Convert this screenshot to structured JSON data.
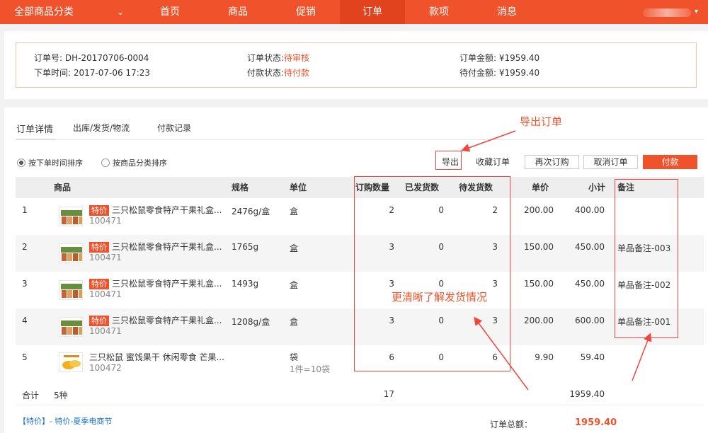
{
  "nav": {
    "category": "全部商品分类",
    "items": [
      "首页",
      "商品",
      "促销",
      "订单",
      "款项",
      "消息"
    ]
  },
  "summary": {
    "order_no_label": "订单号:",
    "order_no": "DH-20170706-0004",
    "order_time_label": "下单时间:",
    "order_time": "2017-07-06 17:23",
    "order_status_label": "订单状态:",
    "order_status": "待审核",
    "pay_status_label": "付款状态:",
    "pay_status": "待付款",
    "amount_label": "订单金额:",
    "amount": "¥1959.40",
    "due_label": "待付金额:",
    "due": "¥1959.40"
  },
  "tabs": [
    "订单详情",
    "出库/发货/物流",
    "付款记录"
  ],
  "sort": {
    "by_time": "按下单时间排序",
    "by_category": "按商品分类排序"
  },
  "actions": {
    "export": "导出",
    "favorite": "收藏订单",
    "reorder": "再次订购",
    "cancel": "取消订单",
    "pay": "付款"
  },
  "table": {
    "headers": {
      "product": "商品",
      "spec": "规格",
      "unit": "单位",
      "ordered": "订购数量",
      "shipped": "已发货数",
      "pending": "待发货数",
      "price": "单价",
      "subtotal": "小计",
      "remark": "备注"
    },
    "rows": [
      {
        "idx": "1",
        "tag": "特价",
        "name": "三只松鼠零食特产干果礼盒...",
        "code": "100471",
        "spec": "2476g/盒",
        "unit": "盒",
        "unit_note": "",
        "ordered": "2",
        "shipped": "0",
        "pending": "2",
        "price": "200.00",
        "subtotal": "400.00",
        "remark": ""
      },
      {
        "idx": "2",
        "tag": "特价",
        "name": "三只松鼠零食特产干果礼盒...",
        "code": "100471",
        "spec": "1765g",
        "unit": "盒",
        "unit_note": "",
        "ordered": "3",
        "shipped": "0",
        "pending": "3",
        "price": "150.00",
        "subtotal": "450.00",
        "remark": "单品备注-003"
      },
      {
        "idx": "3",
        "tag": "特价",
        "name": "三只松鼠零食特产干果礼盒...",
        "code": "100471",
        "spec": "1493g",
        "unit": "盒",
        "unit_note": "",
        "ordered": "3",
        "shipped": "0",
        "pending": "3",
        "price": "150.00",
        "subtotal": "450.00",
        "remark": "单品备注-002"
      },
      {
        "idx": "4",
        "tag": "特价",
        "name": "三只松鼠零食特产干果礼盒...",
        "code": "100471",
        "spec": "1208g/盒",
        "unit": "盒",
        "unit_note": "",
        "ordered": "3",
        "shipped": "0",
        "pending": "3",
        "price": "200.00",
        "subtotal": "600.00",
        "remark": "单品备注-001"
      },
      {
        "idx": "5",
        "tag": "",
        "name": "三只松鼠 蜜饯果干 休闲零食 芒果...",
        "code": "100472",
        "spec": "",
        "unit": "袋",
        "unit_note": "1件=10袋",
        "ordered": "6",
        "shipped": "0",
        "pending": "6",
        "price": "9.90",
        "subtotal": "59.40",
        "remark": ""
      }
    ],
    "total": {
      "label": "合计",
      "kinds": "5种",
      "ordered": "17",
      "subtotal": "1959.40"
    }
  },
  "promo": "【特价】- 特价-夏季电商节",
  "grand_total": {
    "label": "订单总额：",
    "value": "1959.40"
  },
  "annotations": {
    "export_order": "导出订单",
    "shipping_clear": "更清晰了解发货情况"
  },
  "colors": {
    "brand": "#f0522b",
    "annotation": "#f0463c"
  }
}
